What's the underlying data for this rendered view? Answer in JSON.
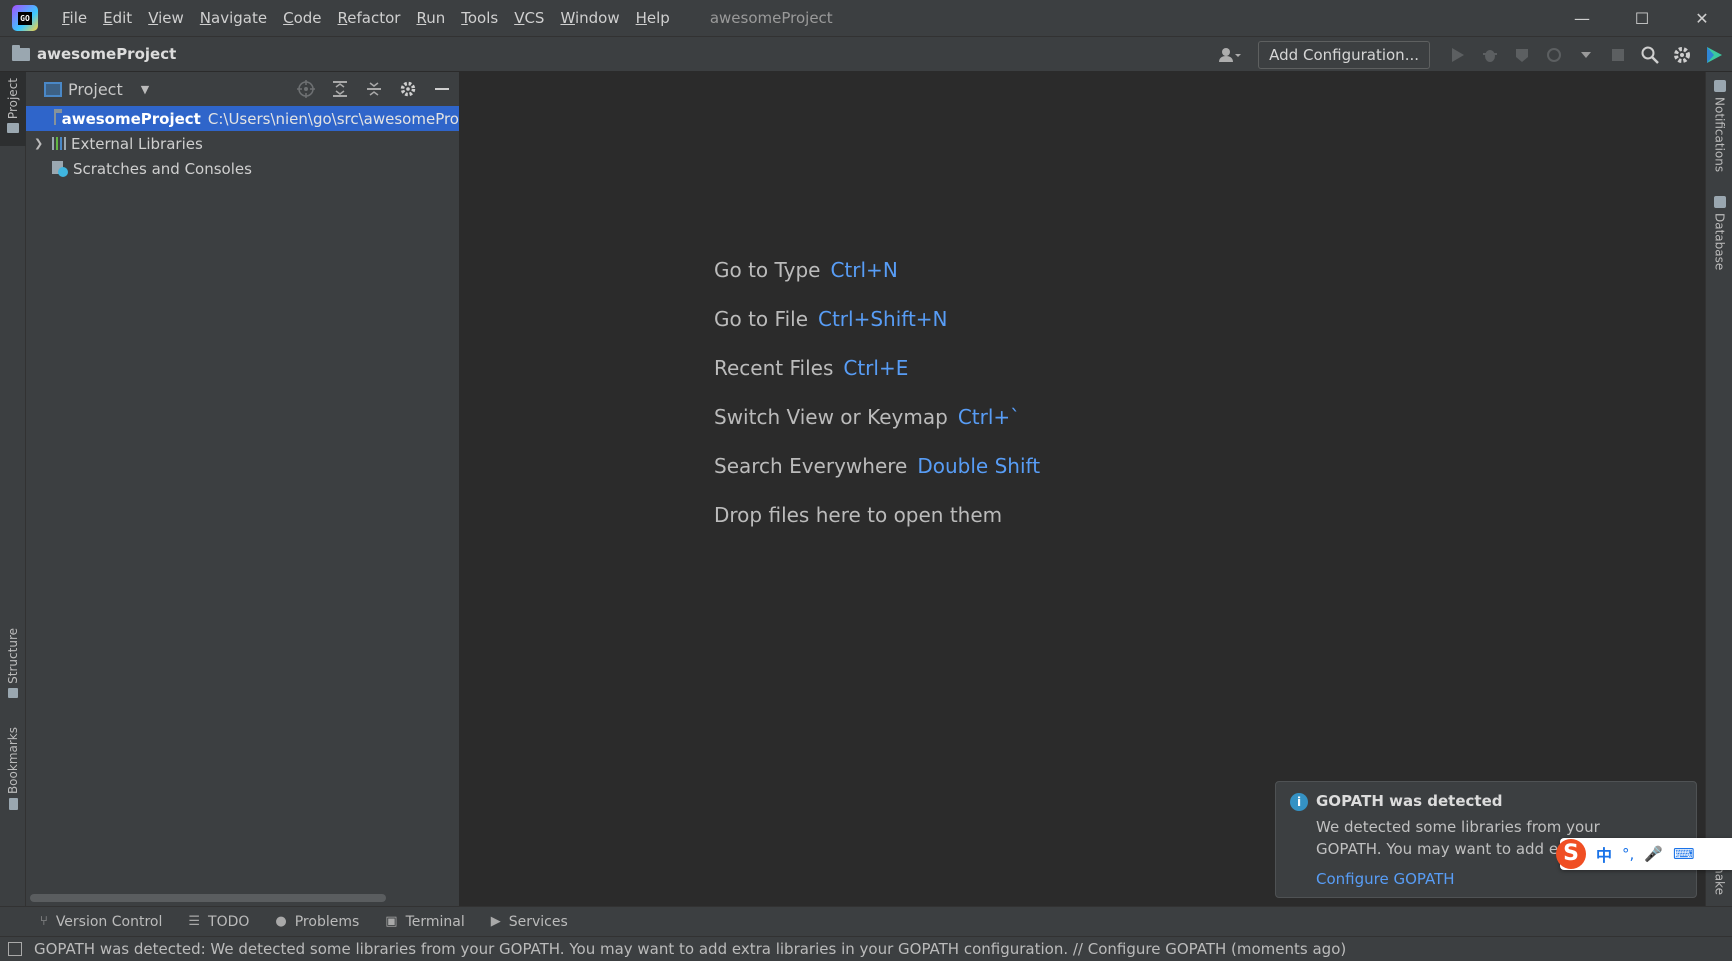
{
  "window": {
    "title": "awesomeProject",
    "logo_text": "GO",
    "controls": {
      "minimize": "—",
      "maximize": "☐",
      "close": "✕"
    }
  },
  "menu": [
    {
      "label": "File"
    },
    {
      "label": "Edit"
    },
    {
      "label": "View"
    },
    {
      "label": "Navigate"
    },
    {
      "label": "Code"
    },
    {
      "label": "Refactor"
    },
    {
      "label": "Run"
    },
    {
      "label": "Tools"
    },
    {
      "label": "VCS"
    },
    {
      "label": "Window"
    },
    {
      "label": "Help"
    }
  ],
  "navbar": {
    "project_name": "awesomeProject",
    "add_configuration": "Add Configuration...",
    "icons": [
      "user-icon",
      "run-icon",
      "debug-icon",
      "coverage-icon",
      "profile-icon",
      "stop-icon",
      "search-icon",
      "settings-icon",
      "plugin-icon"
    ]
  },
  "left_stripe": {
    "project": "Project",
    "structure": "Structure",
    "bookmarks": "Bookmarks"
  },
  "project_panel": {
    "title": "Project",
    "tree": [
      {
        "name": "awesomeProject",
        "path": "C:\\Users\\nien\\go\\src\\awesomePro",
        "selected": true
      },
      {
        "name": "External Libraries",
        "path": ""
      },
      {
        "name": "Scratches and Consoles",
        "path": ""
      }
    ]
  },
  "welcome": [
    {
      "label": "Go to Type",
      "key": "Ctrl+N"
    },
    {
      "label": "Go to File",
      "key": "Ctrl+Shift+N"
    },
    {
      "label": "Recent Files",
      "key": "Ctrl+E"
    },
    {
      "label": "Switch View or Keymap",
      "key": "Ctrl+`"
    },
    {
      "label": "Search Everywhere",
      "key": "Double Shift"
    },
    {
      "label": "Drop files here to open them",
      "key": ""
    }
  ],
  "right_stripe": {
    "notifications": "Notifications",
    "database": "Database",
    "make": "make"
  },
  "notification": {
    "title": "GOPATH was detected",
    "text": "We detected some libraries from your GOPATH. You may want to add ex",
    "link": "Configure GOPATH"
  },
  "ime": {
    "logo": "S",
    "lang": "中",
    "punct": "°,",
    "mic": "🎤",
    "keyboard": "⌨"
  },
  "bottom_tools": [
    {
      "label": "Version Control",
      "icon": "branch-icon"
    },
    {
      "label": "TODO",
      "icon": "list-icon"
    },
    {
      "label": "Problems",
      "icon": "warning-icon"
    },
    {
      "label": "Terminal",
      "icon": "terminal-icon"
    },
    {
      "label": "Services",
      "icon": "services-icon"
    }
  ],
  "status": {
    "text": "GOPATH was detected: We detected some libraries from your GOPATH. You may want to add extra libraries in your GOPATH configuration. // Configure GOPATH (moments ago)"
  }
}
